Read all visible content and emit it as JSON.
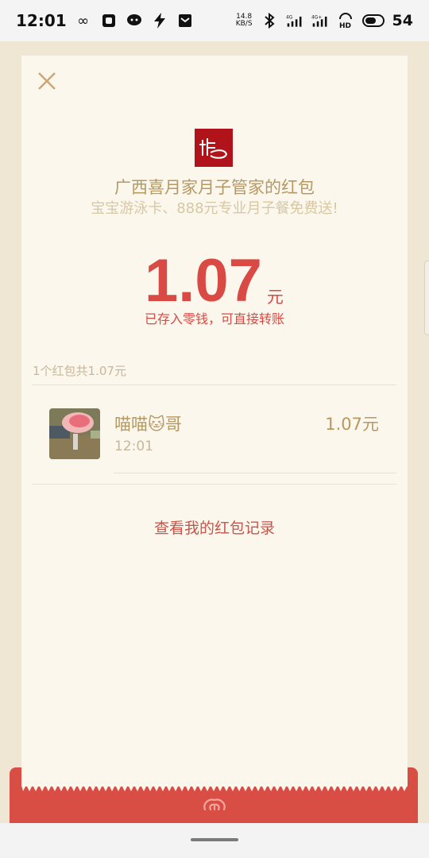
{
  "status_bar": {
    "time": "12:01",
    "net_speed_top": "14.8",
    "net_speed_unit": "KB/S",
    "signal_1": "4G",
    "signal_2": "4G+",
    "hd": "HD",
    "battery_level": "54"
  },
  "envelope": {
    "sender_title": "广西喜月家月子管家的红包",
    "blessing": "宝宝游泳卡、888元专业月子餐免费送!",
    "amount": "1.07",
    "currency": "元",
    "stored_note": "已存入零钱，可直接转账",
    "summary": "1个红包共1.07元",
    "history_link": "查看我的红包记录"
  },
  "records": [
    {
      "name": "喵喵🐱哥",
      "time": "12:01",
      "amount": "1.07元"
    }
  ],
  "colors": {
    "accent_red": "#d84a43",
    "gold_text": "#b79861",
    "card_bg": "#fbf7ec",
    "page_bg": "#efe6d3"
  },
  "icons": [
    "infinity-icon",
    "app-icon",
    "chat-icon",
    "flash-icon",
    "mail-icon",
    "bluetooth-icon",
    "close-icon",
    "logo-icon",
    "envelope-emblem-icon"
  ]
}
